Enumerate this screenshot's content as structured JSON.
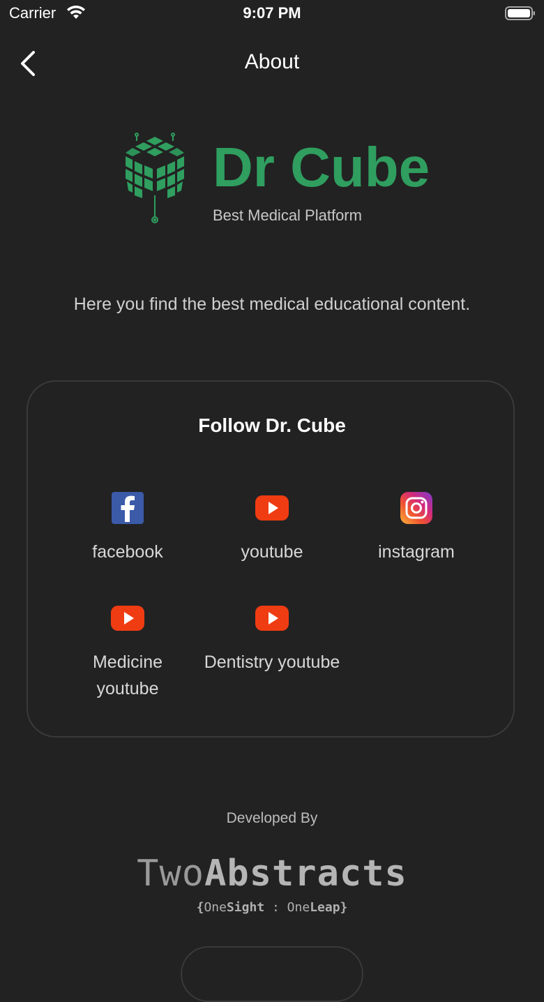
{
  "status_bar": {
    "carrier": "Carrier",
    "time": "9:07 PM"
  },
  "nav": {
    "title": "About",
    "back_icon": "chevron-left-icon"
  },
  "brand": {
    "name": "Dr Cube",
    "tagline": "Best Medical Platform",
    "color": "#2f9e5f"
  },
  "intro": "Here you find the best medical educational content.",
  "follow": {
    "title": "Follow Dr. Cube",
    "links": [
      {
        "label": "facebook",
        "icon": "facebook-icon"
      },
      {
        "label": "youtube",
        "icon": "youtube-icon"
      },
      {
        "label": "instagram",
        "icon": "instagram-icon"
      },
      {
        "label": "Medicine youtube",
        "icon": "youtube-icon"
      },
      {
        "label": "Dentistry youtube",
        "icon": "youtube-icon"
      }
    ]
  },
  "developer": {
    "caption": "Developed By",
    "name_light": "Two",
    "name_bold": "Abstracts",
    "sub_open": "{",
    "sub_a_light": "One",
    "sub_a_bold": "Sight",
    "sub_sep": " : ",
    "sub_b_light": "One",
    "sub_b_bold": "Leap",
    "sub_close": "}"
  }
}
